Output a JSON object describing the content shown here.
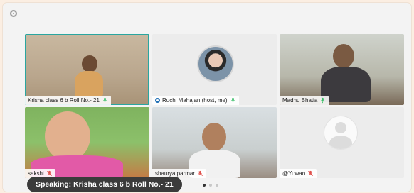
{
  "meeting": {
    "participants": [
      {
        "name": "Krisha class 6 b Roll No.- 21",
        "mic": "on"
      },
      {
        "name": "Ruchi  Mahajan  (host, me)",
        "mic": "on"
      },
      {
        "name": "Madhu Bhatia",
        "mic": "on"
      },
      {
        "name": "sakshi",
        "mic": "muted"
      },
      {
        "name": "shaurya parmar",
        "mic": "muted"
      },
      {
        "name": "@Yuwan",
        "mic": "muted"
      }
    ],
    "speaking_banner": "Speaking: Krisha class 6 b Roll No.- 21",
    "page_count": 3,
    "current_page": 1
  },
  "colors": {
    "active_speaker_border": "#2aa6a0",
    "mic_on": "#3cbf6a",
    "mic_muted": "#e0524d",
    "banner_bg": "#3b3b3b"
  },
  "icons": {
    "mic_on": "microphone-icon",
    "mic_muted": "microphone-muted-icon",
    "host": "host-icon",
    "settings": "settings-icon"
  }
}
